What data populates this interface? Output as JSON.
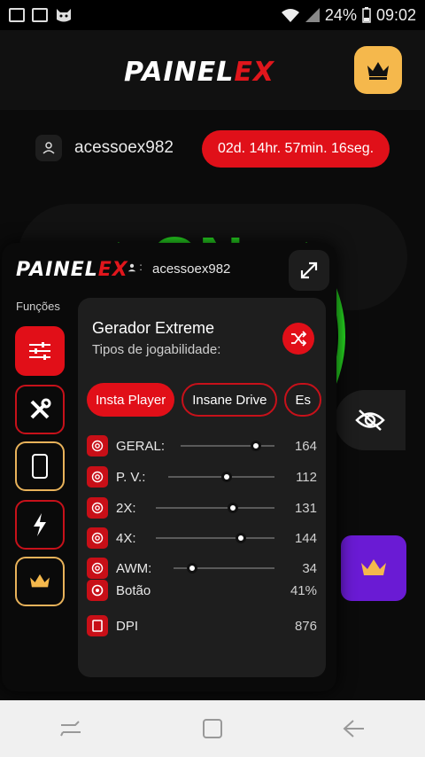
{
  "status_bar": {
    "battery": "24%",
    "time": "09:02",
    "icons": [
      "sim-card-icon",
      "image-icon",
      "cat-icon",
      "wifi-icon",
      "signal-icon",
      "battery-icon"
    ]
  },
  "background_app": {
    "logo_main": "PAINEL",
    "logo_accent": "EX",
    "username": "acessoex982",
    "timer": "02d. 14hr. 57min. 16seg.",
    "status_text": "ON"
  },
  "panel": {
    "logo_main": "PAINEL",
    "logo_accent": "EX",
    "user_prefix": ":",
    "username": "acessoex982",
    "funcoes_label": "Funções",
    "side_buttons": [
      "sliders-icon",
      "tools-icon",
      "phone-icon",
      "lightning-icon",
      "crown-icon"
    ],
    "card": {
      "title": "Gerador Extreme",
      "subtitle": "Tipos de jogabilidade:",
      "chips": [
        "Insta Player",
        "Insane Drive",
        "Es"
      ],
      "sliders": [
        {
          "label": "GERAL:",
          "value": "164",
          "fraction": 0.8
        },
        {
          "label": "P. V.:",
          "value": "112",
          "fraction": 0.55
        },
        {
          "label": "2X:",
          "value": "131",
          "fraction": 0.65
        },
        {
          "label": "4X:",
          "value": "144",
          "fraction": 0.72
        },
        {
          "label": "AWM:",
          "value": "34",
          "fraction": 0.18
        }
      ],
      "info": [
        {
          "label": "Botão",
          "value": "41%"
        },
        {
          "label": "DPI",
          "value": "876"
        }
      ]
    }
  },
  "colors": {
    "accent_red": "#e10f18",
    "accent_green": "#28e022",
    "accent_gold": "#f5b84c",
    "accent_purple": "#6a1bd4"
  }
}
